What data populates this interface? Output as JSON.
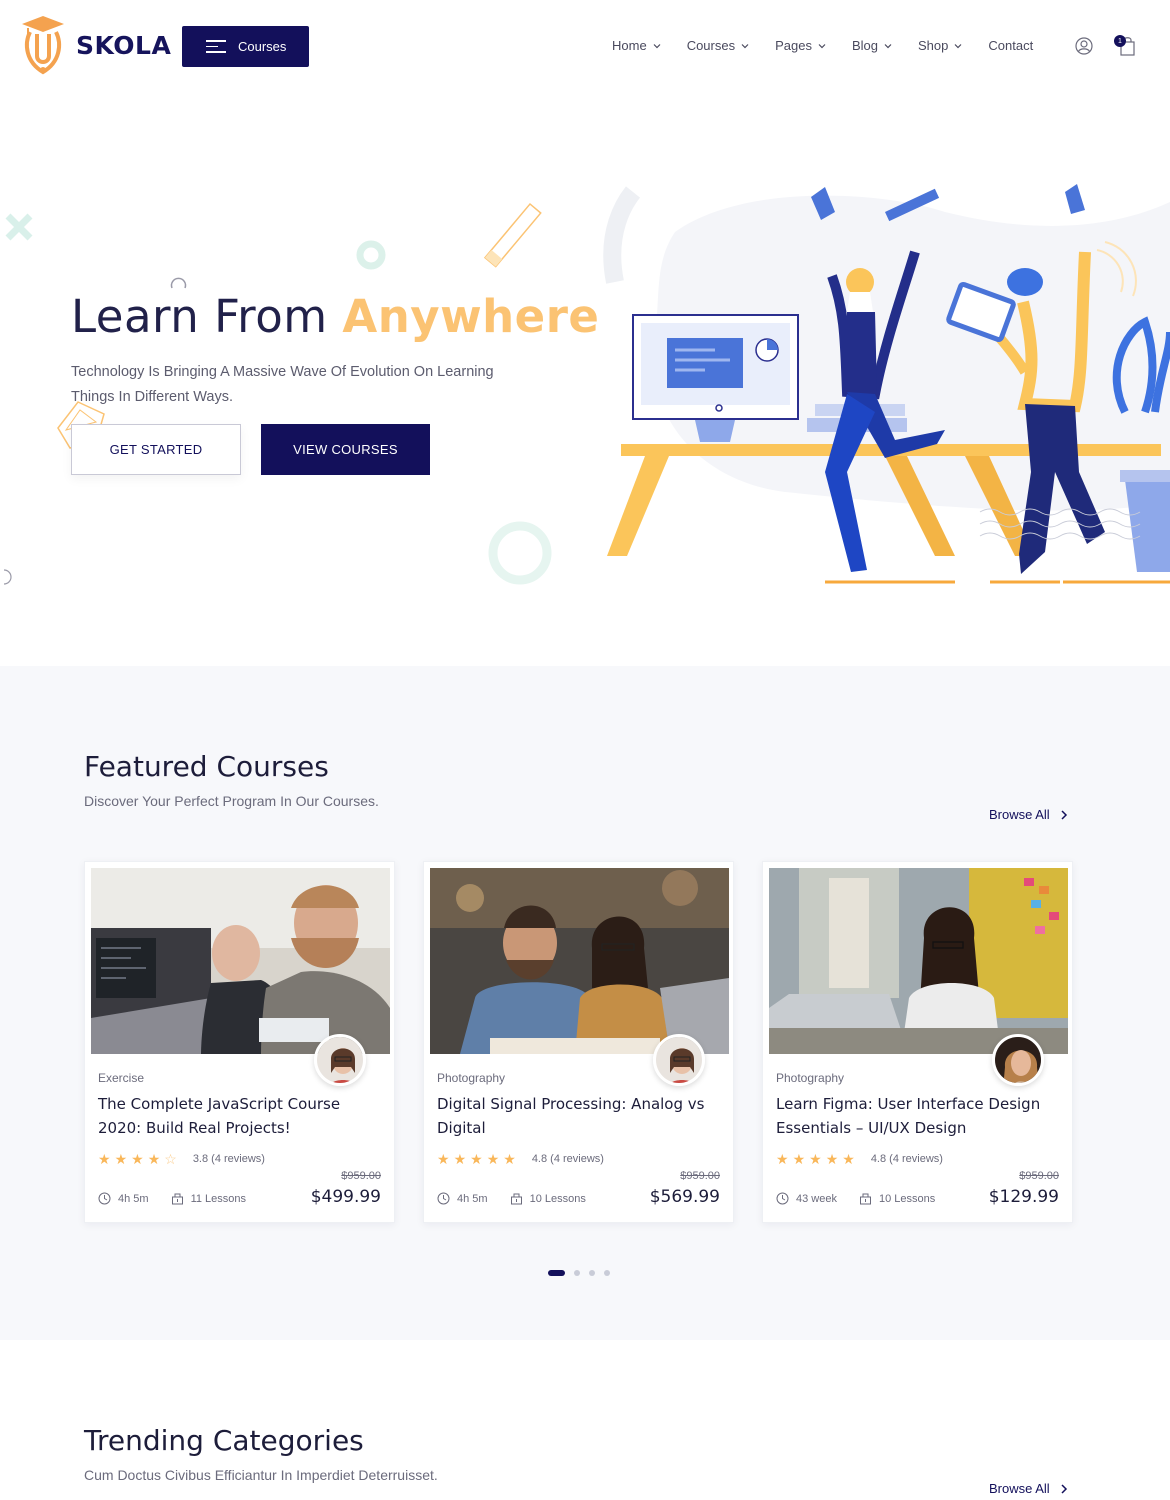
{
  "header": {
    "brand": "SKOLA",
    "categories_button": "Courses",
    "nav": [
      {
        "label": "Home",
        "has_dropdown": true
      },
      {
        "label": "Courses",
        "has_dropdown": true
      },
      {
        "label": "Pages",
        "has_dropdown": true
      },
      {
        "label": "Blog",
        "has_dropdown": true
      },
      {
        "label": "Shop",
        "has_dropdown": true
      },
      {
        "label": "Contact",
        "has_dropdown": false
      }
    ],
    "cart_count": "1"
  },
  "hero": {
    "title_part1": "Learn From ",
    "title_highlight": "Anywhere",
    "subtitle": "Technology Is Bringing A Massive Wave Of Evolution On Learning Things In Different Ways.",
    "btn_primary": "GET STARTED",
    "btn_secondary": "VIEW COURSES"
  },
  "featured": {
    "title": "Featured Courses",
    "subtitle": "Discover Your Perfect Program In Our Courses.",
    "browse_all": "Browse All",
    "courses": [
      {
        "category": "Exercise",
        "title": "The Complete JavaScript Course 2020: Build Real Projects!",
        "rating": "3.8",
        "reviews": "(4 reviews)",
        "stars_full": 4,
        "old_price": "$959.00",
        "duration": "4h 5m",
        "lessons": "11 Lessons",
        "price": "$499.99"
      },
      {
        "category": "Photography",
        "title": "Digital Signal Processing: Analog vs Digital",
        "rating": "4.8",
        "reviews": "(4 reviews)",
        "stars_full": 5,
        "old_price": "$959.00",
        "duration": "4h 5m",
        "lessons": "10 Lessons",
        "price": "$569.99"
      },
      {
        "category": "Photography",
        "title": "Learn Figma: User Interface Design Essentials – UI/UX Design",
        "rating": "4.8",
        "reviews": "(4 reviews)",
        "stars_full": 5,
        "old_price": "$959.00",
        "duration": "43 week",
        "lessons": "10 Lessons",
        "price": "$129.99"
      }
    ],
    "pager_total": 4,
    "pager_active": 1
  },
  "trending": {
    "title": "Trending Categories",
    "subtitle": "Cum Doctus Civibus Efficiantur In Imperdiet Deterruisset.",
    "browse_all": "Browse All"
  },
  "colors": {
    "brand_navy": "#13105b",
    "accent_orange": "#fbc373",
    "star": "#f9b75a"
  }
}
